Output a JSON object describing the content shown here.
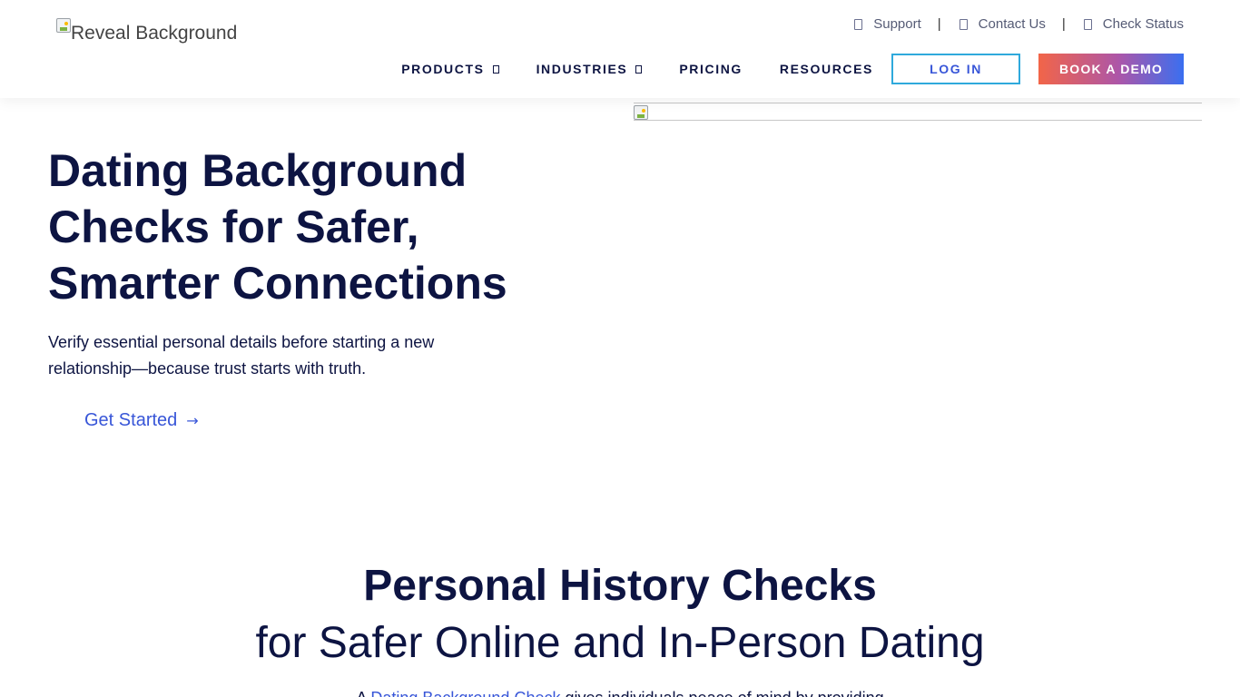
{
  "header": {
    "logo_alt": "Reveal Background",
    "top_links": [
      {
        "label": "Support",
        "icon": "headset-icon"
      },
      {
        "label": "Contact Us",
        "icon": "phone-icon"
      },
      {
        "label": "Check Status",
        "icon": "status-icon"
      }
    ],
    "separator": "|",
    "nav": {
      "products": "PRODUCTS",
      "industries": "INDUSTRIES",
      "pricing": "PRICING",
      "resources": "RESOURCES"
    },
    "login_label": "LOG IN",
    "demo_label": "BOOK A DEMO"
  },
  "hero": {
    "title": "Dating Background Checks for Safer, Smarter Connections",
    "subtitle": "Verify essential personal details before starting a new relationship—because trust starts with truth.",
    "cta_label": "Get Started",
    "cta_arrow": "→"
  },
  "section": {
    "title": "Personal History Checks",
    "subtitle": "for Safer Online and In-Person Dating",
    "para_prefix": "A ",
    "para_link": "Dating Background Check",
    "para_suffix": " gives individuals peace of mind by providing"
  },
  "colors": {
    "navy": "#0d1442",
    "link_blue": "#3856d8",
    "login_border": "#2fa9dc",
    "demo_gradient_start": "#f26548",
    "demo_gradient_end": "#3a6ff0"
  }
}
